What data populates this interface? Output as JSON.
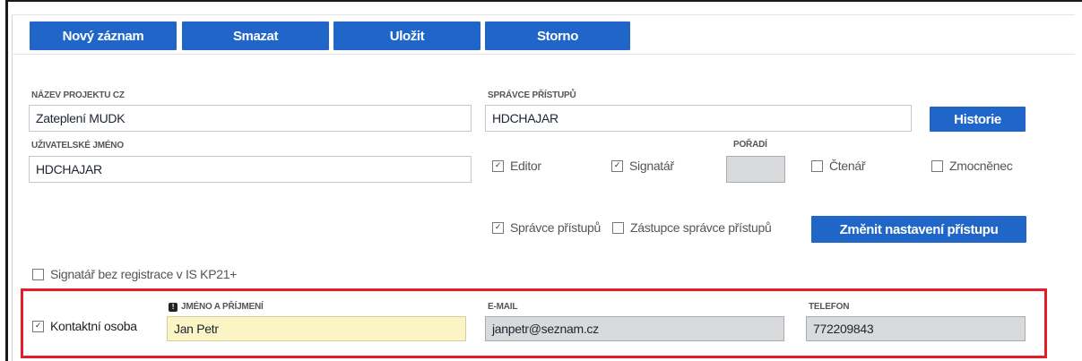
{
  "toolbar": {
    "new_record": "Nový záznam",
    "delete": "Smazat",
    "save": "Uložit",
    "cancel": "Storno"
  },
  "form": {
    "project_name": {
      "label": "NÁZEV PROJEKTU CZ",
      "value": "Zateplení MUDK"
    },
    "access_admin": {
      "label": "SPRÁVCE PŘÍSTUPŮ",
      "value": "HDCHAJAR"
    },
    "history_button": "Historie",
    "username": {
      "label": "UŽIVATELSKÉ JMÉNO",
      "value": "HDCHAJAR"
    },
    "order": {
      "label": "POŘADÍ",
      "value": ""
    },
    "roles": {
      "editor": {
        "label": "Editor",
        "checked": true
      },
      "signatory": {
        "label": "Signatář",
        "checked": true
      },
      "reader": {
        "label": "Čtenář",
        "checked": false
      },
      "proxy": {
        "label": "Zmocněnec",
        "checked": false
      }
    },
    "admin_rights": {
      "access_admin": {
        "label": "Správce přístupů",
        "checked": true
      },
      "access_admin_deputy": {
        "label": "Zástupce správce přístupů",
        "checked": false
      }
    },
    "change_access_button": "Změnit nastavení přístupu",
    "unregistered_signatory": {
      "label": "Signatář bez registrace v IS KP21+",
      "checked": false
    }
  },
  "contact": {
    "contact_person": {
      "label": "Kontaktní osoba",
      "checked": true
    },
    "name": {
      "label": "JMÉNO A PŘÍJMENÍ",
      "value": "Jan Petr"
    },
    "email": {
      "label": "E-MAIL",
      "value": "janpetr@seznam.cz"
    },
    "phone": {
      "label": "TELEFON",
      "value": "772209843"
    }
  },
  "colors": {
    "button_blue": "#1f66c8",
    "highlight_red": "#e11f2b",
    "required_yellow": "#fbf4c4",
    "readonly_grey": "#d9dadc"
  }
}
